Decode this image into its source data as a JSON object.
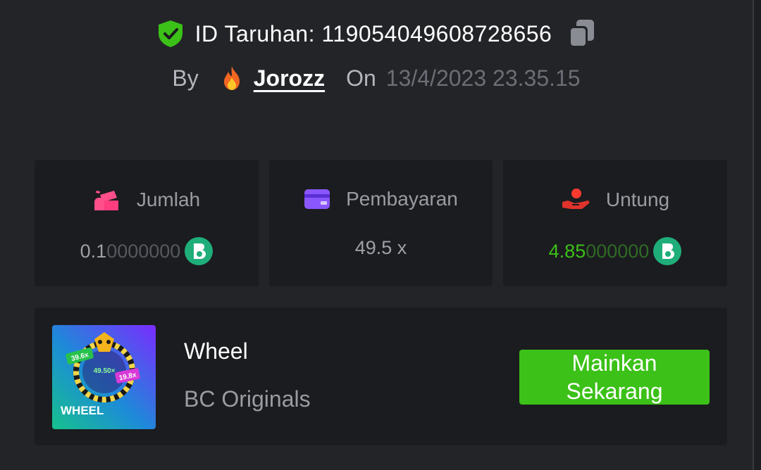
{
  "header": {
    "bet_id": "ID Taruhan: 119054049608728656",
    "by_label": "By",
    "username": "Jorozz",
    "on_label": "On",
    "datetime": "13/4/2023 23.35.15"
  },
  "stats": [
    {
      "label": "Jumlah",
      "value_main": "0.1",
      "value_faint": "0000000",
      "icon": "bag-icon",
      "coin": "bc-coin-icon"
    },
    {
      "label": "Pembayaran",
      "value": "49.5 x",
      "icon": "card-icon"
    },
    {
      "label": "Untung",
      "value_main": "4.85",
      "value_faint": "000000",
      "icon": "hand-coin-icon",
      "coin": "bc-coin-icon"
    }
  ],
  "game": {
    "title": "Wheel",
    "provider": "BC Originals",
    "play_label": "Mainkan Sekarang",
    "thumb": {
      "name": "WHEEL",
      "badge1": "39.6x",
      "badge2": "49.50×",
      "badge3": "19.8x"
    }
  },
  "colors": {
    "background": "#232428",
    "card": "#1b1c1f",
    "accent_green": "#3bc117",
    "shield_green": "#3bc117",
    "coin_teal": "#1fae7a"
  }
}
